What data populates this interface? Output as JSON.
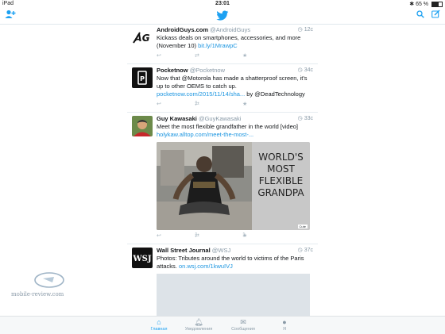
{
  "status_bar": {
    "device": "iPad",
    "time": "23:01",
    "battery": "65 %"
  },
  "tweets": [
    {
      "name": "AndroidGuys.com",
      "handle": "@AndroidGuys",
      "time": "12с",
      "text": "Kickass deals on smartphones, accessories, and more (November 10) ",
      "link": "bit.ly/1MrawpC",
      "retweets": "",
      "likes": ""
    },
    {
      "name": "Pocketnow",
      "handle": "@Pocketnow",
      "time": "34с",
      "text": "Now that @Motorola has made a shatterproof screen, it's up to other OEMS to catch up. ",
      "link": "pocketnow.com/2015/11/14/sha...",
      "text_after": " by @DeadTechnology",
      "retweets": "1",
      "likes": ""
    },
    {
      "name": "Guy Kawasaki",
      "handle": "@GuyKawasaki",
      "time": "33с",
      "text": "Meet the most flexible grandfather in the world [video] ",
      "link": "holykaw.alltop.com/meet-the-most-...",
      "retweets": "1",
      "likes": "1",
      "media_caption": [
        "WORLD'S",
        "MOST",
        "FLEXIBLE",
        "GRANDPA"
      ],
      "media_credit": "Cute"
    },
    {
      "name": "Wall Street Journal",
      "handle": "@WSJ",
      "time": "37с",
      "text": "Photos: Tributes around the world to victims of the Paris attacks. ",
      "link": "on.wsj.com/1kwuIVJ"
    }
  ],
  "tab_bar": [
    {
      "label": "Главная",
      "icon": "home-icon",
      "active": true
    },
    {
      "label": "Уведомления",
      "icon": "bell-icon",
      "active": false
    },
    {
      "label": "Сообщения",
      "icon": "envelope-icon",
      "active": false
    },
    {
      "label": "Я",
      "icon": "person-icon",
      "active": false
    }
  ],
  "watermark": "mobile-review.com",
  "colors": {
    "accent": "#1da1f2",
    "link": "#1b95e0"
  }
}
